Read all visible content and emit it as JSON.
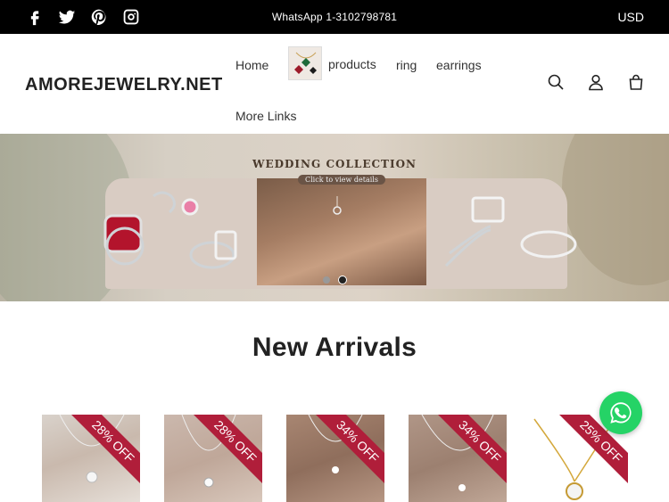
{
  "topbar": {
    "social_icons": [
      "facebook-icon",
      "twitter-icon",
      "pinterest-icon",
      "instagram-icon"
    ],
    "whatsapp_text": "WhatsApp 1-3102798781",
    "currency": "USD",
    "background": "#000000"
  },
  "header": {
    "logo": "AMOREJEWELRY.NET",
    "nav": {
      "home": "Home",
      "products": "products",
      "ring": "ring",
      "earrings": "earrings",
      "more": "More Links"
    },
    "icons": [
      "search-icon",
      "account-icon",
      "cart-icon"
    ]
  },
  "banner": {
    "title": "WEDDING COLLECTION",
    "subtitle": "Click to view details",
    "slides": 2,
    "active_slide": 2
  },
  "new_arrivals": {
    "title": "New Arrivals",
    "products": [
      {
        "discount": "28% OFF"
      },
      {
        "discount": "28% OFF"
      },
      {
        "discount": "34% OFF"
      },
      {
        "discount": "34% OFF"
      },
      {
        "discount": "25% OFF"
      }
    ],
    "ribbon_color": "#b01e3a"
  },
  "whatsapp_float": {
    "icon": "whatsapp-icon",
    "color": "#25d366"
  }
}
